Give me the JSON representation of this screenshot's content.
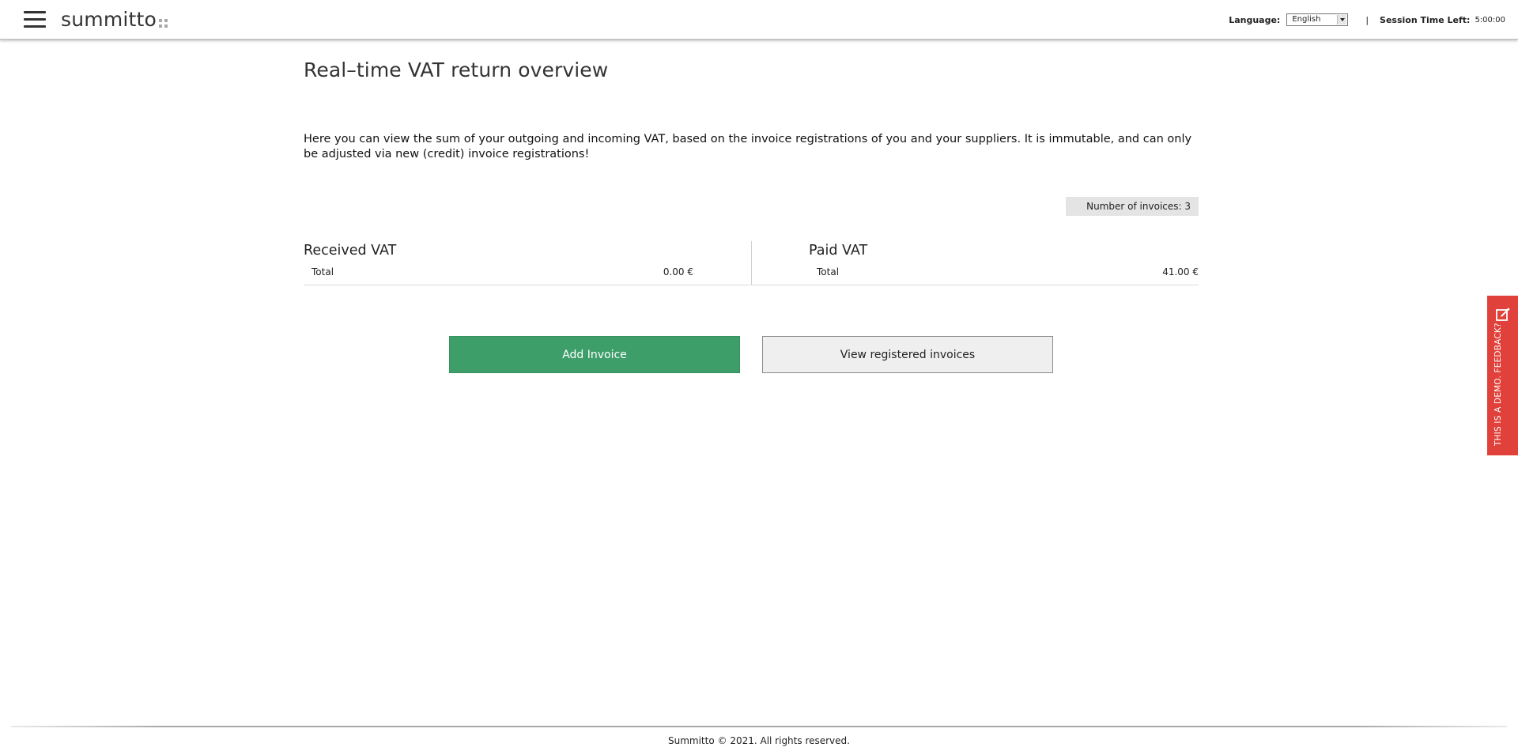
{
  "header": {
    "logo_text": "summitto",
    "language_label": "Language:",
    "language_selected": "English",
    "separator": "|",
    "session_label": "Session Time Left:",
    "session_time": "5:00:00"
  },
  "main": {
    "title": "Real–time VAT return overview",
    "intro": "Here you can view the sum of your outgoing and incoming VAT, based on the invoice registrations of you and your suppliers. It is immutable, and can only be adjusted via new (credit) invoice registrations!",
    "invoice_count": "Number of invoices: 3",
    "received": {
      "title": "Received VAT",
      "total_label": "Total",
      "total_value": "0.00 €"
    },
    "paid": {
      "title": "Paid VAT",
      "total_label": "Total",
      "total_value": "41.00 €"
    },
    "buttons": {
      "add_invoice": "Add Invoice",
      "view_invoices": "View registered invoices"
    }
  },
  "feedback": {
    "label": "THIS IS A DEMO. FEEDBACK?",
    "icon": "edit-note-icon",
    "color": "#e0413a"
  },
  "footer": {
    "text": "Summitto © 2021. All rights reserved."
  },
  "colors": {
    "accent_green": "#3d9e6a",
    "feedback_red": "#e0413a"
  }
}
